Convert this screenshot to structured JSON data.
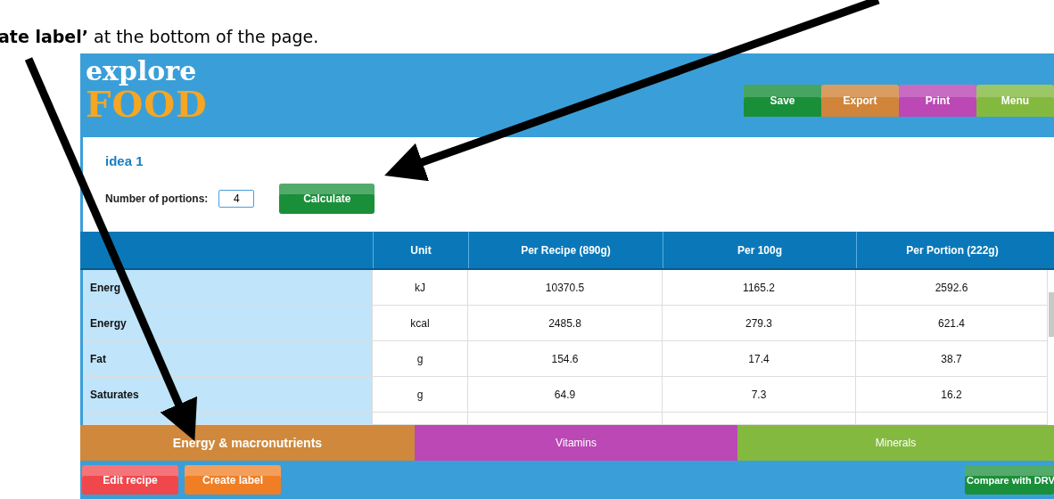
{
  "document_text": "**ate label’** at the bottom of the page.",
  "logo": {
    "top": "explore",
    "bottom": "FOOD"
  },
  "header": {
    "buttons": [
      {
        "label": "Save",
        "color": "#1a8f3a"
      },
      {
        "label": "Export",
        "color": "#d0853a"
      },
      {
        "label": "Print",
        "color": "#bb48b5"
      },
      {
        "label": "Menu",
        "color": "#84b940"
      }
    ]
  },
  "recipe": {
    "title": "idea 1",
    "portions_label": "Number of portions:",
    "portions_value": "4",
    "calculate_button": "Calculate"
  },
  "table": {
    "columns": [
      "",
      "Unit",
      "Per Recipe (890g)",
      "Per 100g",
      "Per Portion (222g)"
    ],
    "rows": [
      [
        "Energ",
        "kJ",
        "10370.5",
        "1165.2",
        "2592.6"
      ],
      [
        "Energy",
        "kcal",
        "2485.8",
        "279.3",
        "621.4"
      ],
      [
        "Fat",
        "g",
        "154.6",
        "17.4",
        "38.7"
      ],
      [
        "Saturates",
        "g",
        "64.9",
        "7.3",
        "16.2"
      ]
    ]
  },
  "tabs": [
    {
      "label": "Energy & macronutrients",
      "selected": true,
      "color": "#d0883c"
    },
    {
      "label": "Vitamins",
      "selected": false,
      "color": "#bb48b5"
    },
    {
      "label": "Minerals",
      "selected": false,
      "color": "#84b940"
    }
  ],
  "footer": {
    "buttons": [
      {
        "label": "Edit recipe",
        "color": "#f0474d"
      },
      {
        "label": "Create label",
        "color": "#f07e25"
      }
    ],
    "right_button": {
      "label": "Compare with DRV",
      "color": "#1a8f3a"
    }
  }
}
